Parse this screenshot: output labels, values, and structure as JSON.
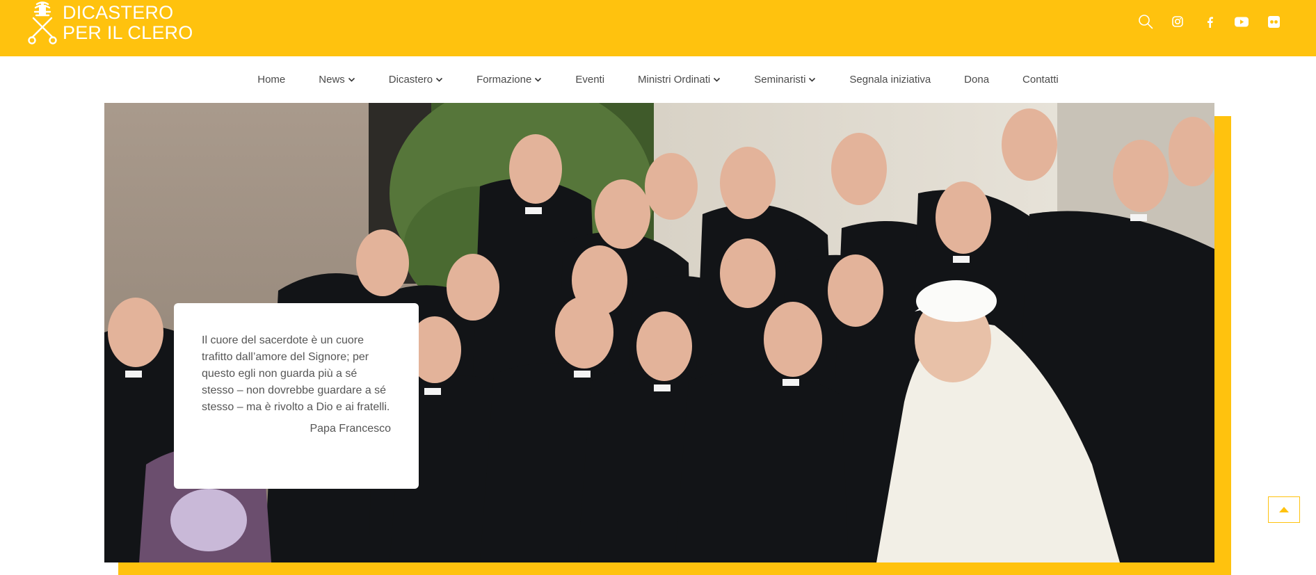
{
  "brand": {
    "line1": "DICASTERO",
    "line2": "PER IL CLERO",
    "accent_color": "#FFC20E"
  },
  "social": [
    {
      "icon": "search-icon"
    },
    {
      "icon": "instagram-icon"
    },
    {
      "icon": "facebook-icon"
    },
    {
      "icon": "youtube-icon"
    },
    {
      "icon": "flickr-icon"
    }
  ],
  "nav": {
    "items": [
      {
        "label": "Home",
        "has_dropdown": false
      },
      {
        "label": "News",
        "has_dropdown": true
      },
      {
        "label": "Dicastero",
        "has_dropdown": true
      },
      {
        "label": "Formazione",
        "has_dropdown": true
      },
      {
        "label": "Eventi",
        "has_dropdown": false
      },
      {
        "label": "Ministri Ordinati",
        "has_dropdown": true
      },
      {
        "label": "Seminaristi",
        "has_dropdown": true
      },
      {
        "label": "Segnala iniziativa",
        "has_dropdown": false
      },
      {
        "label": "Dona",
        "has_dropdown": false
      },
      {
        "label": "Contatti",
        "has_dropdown": false
      }
    ]
  },
  "hero": {
    "quote": "Il cuore del sacerdote è un cuore trafitto dall’amore del Signore; per questo egli non guarda più a sé stesso – non dovrebbe guardare a sé stesso – ma è rivolto a Dio e ai fratelli.",
    "author": "Papa Francesco"
  },
  "scroll_top": {
    "icon": "arrow-up-icon"
  }
}
